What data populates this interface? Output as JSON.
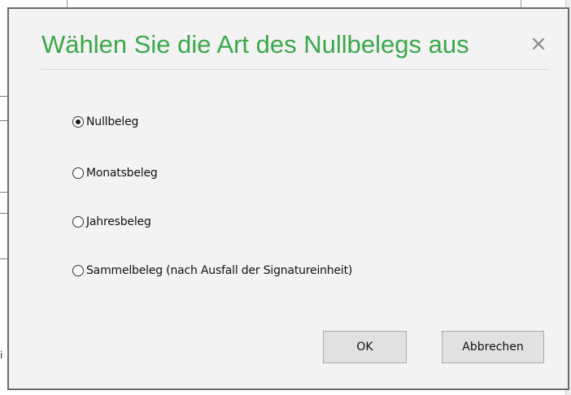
{
  "dialog": {
    "title": "Wählen Sie die Art des Nullbelegs aus",
    "close_glyph": "×",
    "accent_color": "#3aa84a",
    "options": [
      {
        "label": "Nullbeleg",
        "selected": true
      },
      {
        "label": "Monatsbeleg",
        "selected": false
      },
      {
        "label": "Jahresbeleg",
        "selected": false
      },
      {
        "label": "Sammelbeleg (nach Ausfall der Signatureinheit)",
        "selected": false
      }
    ],
    "ok_label": "OK",
    "cancel_label": "Abbrechen"
  },
  "background": {
    "left_fragment_text": "i"
  }
}
